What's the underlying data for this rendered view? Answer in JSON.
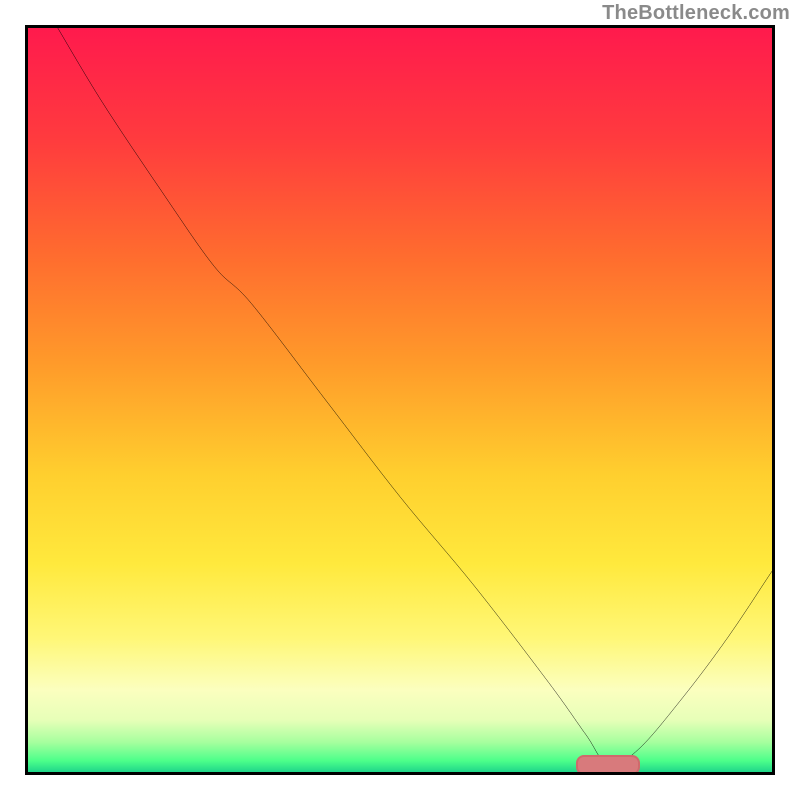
{
  "watermark": "TheBottleneck.com",
  "colors": {
    "border": "#000000",
    "curve": "#000000",
    "marker_fill": "#d87a7c",
    "marker_border": "#cf6a6c",
    "gradient_stops": [
      {
        "offset": 0.0,
        "color": "#ff1a4d"
      },
      {
        "offset": 0.15,
        "color": "#ff3b3e"
      },
      {
        "offset": 0.3,
        "color": "#ff6a2f"
      },
      {
        "offset": 0.45,
        "color": "#ff9a2a"
      },
      {
        "offset": 0.6,
        "color": "#ffcf2e"
      },
      {
        "offset": 0.72,
        "color": "#ffe93d"
      },
      {
        "offset": 0.82,
        "color": "#fff777"
      },
      {
        "offset": 0.89,
        "color": "#fbffbf"
      },
      {
        "offset": 0.93,
        "color": "#e7ffb8"
      },
      {
        "offset": 0.96,
        "color": "#a6ff9e"
      },
      {
        "offset": 0.985,
        "color": "#4cff8a"
      },
      {
        "offset": 1.0,
        "color": "#1fd68a"
      }
    ]
  },
  "chart_data": {
    "type": "line",
    "title": "",
    "xlabel": "",
    "ylabel": "",
    "xlim": [
      0,
      100
    ],
    "ylim": [
      0,
      100
    ],
    "note": "y represents bottleneck percentage (top = 100, bottom = 0); curve reaches minimum near x≈78 marked by the pink pill",
    "series": [
      {
        "name": "bottleneck-curve",
        "x": [
          4,
          10,
          18,
          25,
          30,
          40,
          50,
          60,
          70,
          75,
          78,
          82,
          88,
          94,
          100
        ],
        "y": [
          100,
          90,
          78,
          68,
          63,
          50,
          37,
          25,
          12,
          5,
          1,
          3,
          10,
          18,
          27
        ]
      }
    ],
    "marker": {
      "x": 78,
      "y": 1
    }
  }
}
